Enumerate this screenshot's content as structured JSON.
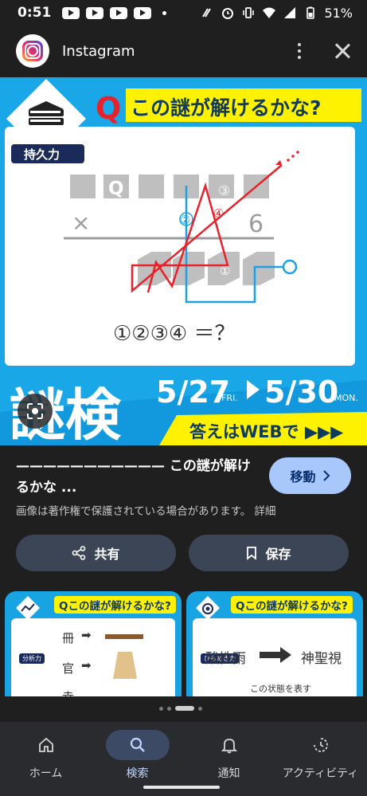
{
  "status_bar": {
    "time": "0:51",
    "battery": "51%"
  },
  "app": {
    "title": "Instagram"
  },
  "image": {
    "headline_q": "Q",
    "headline": "この謎が解けるかな?",
    "badge": "持久力",
    "row_q": "Q",
    "times": "×",
    "six": "6",
    "n1": "①",
    "n2": "②",
    "n3": "③",
    "n4": "④",
    "equation": "①②③④ ＝？",
    "big_title": "謎検",
    "date1": "5/27",
    "day1": "FRI.",
    "date2": "5/30",
    "day2": "MON.",
    "answer_banner": "答えはWEBで ▶▶▶"
  },
  "caption": "——————————— この謎が解けるかな ...",
  "move_button": "移動",
  "copyright": "画像は著作権で保護されている場合があります。 詳細",
  "actions": {
    "share": "共有",
    "save": "保存"
  },
  "thumbnails": [
    {
      "headline": "Qこの謎が解けるかな?",
      "badge": "分析力",
      "rows": [
        "冊",
        "官",
        "幸"
      ]
    },
    {
      "headline": "Qこの謎が解けるかな?",
      "badge": "ひらめき力",
      "left": "酸性雨",
      "right": "神聖視",
      "note": "この状態を表す"
    }
  ],
  "nav": {
    "items": [
      {
        "label": "ホーム",
        "icon": "home-icon"
      },
      {
        "label": "検索",
        "icon": "search-icon"
      },
      {
        "label": "通知",
        "icon": "bell-icon"
      },
      {
        "label": "アクティビティ",
        "icon": "activity-icon"
      }
    ],
    "active_index": 1
  },
  "colors": {
    "background": "#1f1f1f",
    "image_blue": "#19a7e8",
    "accent_yellow": "#fff200",
    "button_blue": "#a8c7fa",
    "action_button": "#3c4556"
  }
}
